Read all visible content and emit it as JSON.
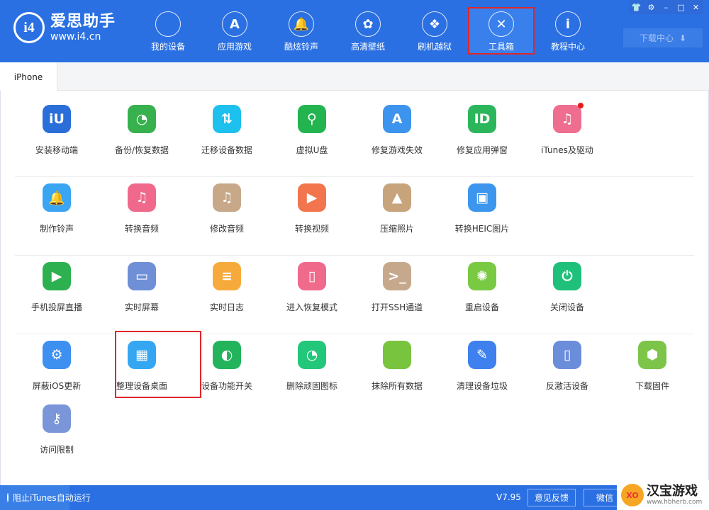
{
  "app": {
    "logo_mark": "i4",
    "name": "爱思助手",
    "url": "www.i4.cn"
  },
  "nav": [
    {
      "label": "我的设备",
      "icon": "apple-icon",
      "glyph": ""
    },
    {
      "label": "应用游戏",
      "icon": "app-store-icon",
      "glyph": "A"
    },
    {
      "label": "酷炫铃声",
      "icon": "bell-icon",
      "glyph": "🔔"
    },
    {
      "label": "高清壁纸",
      "icon": "flower-icon",
      "glyph": "✿"
    },
    {
      "label": "刷机越狱",
      "icon": "box-icon",
      "glyph": "❖"
    },
    {
      "label": "工具箱",
      "icon": "tools-icon",
      "glyph": "✕",
      "active": true
    },
    {
      "label": "教程中心",
      "icon": "info-icon",
      "glyph": "i"
    }
  ],
  "window_controls": {
    "skin": "👕",
    "settings": "⚙",
    "minimize": "–",
    "maximize": "□",
    "close": "✕"
  },
  "download_center": {
    "label": "下载中心",
    "glyph": "⬇"
  },
  "tabs": [
    {
      "label": "iPhone"
    }
  ],
  "tools": [
    {
      "label": "安装移动端",
      "icon": "i4-icon",
      "glyph": "iU",
      "color": "#2a6fd9"
    },
    {
      "label": "备份/恢复数据",
      "icon": "backup-clock-icon",
      "glyph": "◔",
      "color": "#36b14d"
    },
    {
      "label": "迁移设备数据",
      "icon": "transfer-phones-icon",
      "glyph": "⇅",
      "color": "#1ec0ee"
    },
    {
      "label": "虚拟U盘",
      "icon": "usb-icon",
      "glyph": "⚲",
      "color": "#23b450"
    },
    {
      "label": "修复游戏失效",
      "icon": "app-store-repair-icon",
      "glyph": "A",
      "color": "#3d94ee"
    },
    {
      "label": "修复应用弹窗",
      "icon": "apple-id-icon",
      "glyph": "ID",
      "color": "#2cb65c"
    },
    {
      "label": "iTunes及驱动",
      "icon": "itunes-icon",
      "glyph": "♫",
      "color": "#ef6d8e",
      "badge": true
    },
    {
      "label": "制作铃声",
      "icon": "bell-plus-icon",
      "glyph": "🔔",
      "color": "#3aa5f2"
    },
    {
      "label": "转换音频",
      "icon": "music-convert-icon",
      "glyph": "♫",
      "color": "#f0698d"
    },
    {
      "label": "修改音频",
      "icon": "music-edit-icon",
      "glyph": "♫",
      "color": "#c7a98a"
    },
    {
      "label": "转换视频",
      "icon": "video-play-icon",
      "glyph": "▶",
      "color": "#f2754d"
    },
    {
      "label": "压缩照片",
      "icon": "photo-icon",
      "glyph": "▲",
      "color": "#c8a47c"
    },
    {
      "label": "转换HEIC图片",
      "icon": "heic-image-icon",
      "glyph": "▣",
      "color": "#3d96ee"
    },
    {
      "label": "手机投屏直播",
      "icon": "phone-stream-icon",
      "glyph": "▶",
      "color": "#2db04f"
    },
    {
      "label": "实时屏幕",
      "icon": "monitor-icon",
      "glyph": "▭",
      "color": "#6f8fd6"
    },
    {
      "label": "实时日志",
      "icon": "log-document-icon",
      "glyph": "≡",
      "color": "#f7aa3c"
    },
    {
      "label": "进入恢复模式",
      "icon": "recovery-phone-icon",
      "glyph": "▯",
      "color": "#f06a8c"
    },
    {
      "label": "打开SSH通道",
      "icon": "terminal-icon",
      "glyph": ">_",
      "color": "#c6a98d"
    },
    {
      "label": "重启设备",
      "icon": "restart-icon",
      "glyph": "✺",
      "color": "#7ac943"
    },
    {
      "label": "关闭设备",
      "icon": "power-icon",
      "glyph": "⏻",
      "color": "#1fc17a"
    },
    {
      "label": "屏蔽iOS更新",
      "icon": "gear-block-icon",
      "glyph": "⚙",
      "color": "#3d8ff0"
    },
    {
      "label": "整理设备桌面",
      "icon": "grid-icon",
      "glyph": "▦",
      "color": "#35a7f2",
      "highlight": true
    },
    {
      "label": "设备功能开关",
      "icon": "toggle-icon",
      "glyph": "◐",
      "color": "#23b45b"
    },
    {
      "label": "删除顽固图标",
      "icon": "pie-icon",
      "glyph": "◔",
      "color": "#22c77a"
    },
    {
      "label": "抹除所有数据",
      "icon": "apple-erase-icon",
      "glyph": "",
      "color": "#79c43f"
    },
    {
      "label": "清理设备垃圾",
      "icon": "broom-icon",
      "glyph": "✎",
      "color": "#3e80ee"
    },
    {
      "label": "反激活设备",
      "icon": "deactivate-phone-icon",
      "glyph": "▯",
      "color": "#6b8edb"
    },
    {
      "label": "下载固件",
      "icon": "cube-icon",
      "glyph": "⬢",
      "color": "#7cc548"
    },
    {
      "label": "访问限制",
      "icon": "key-icon",
      "glyph": "⚷",
      "color": "#7a96d8"
    }
  ],
  "footer": {
    "itunes_block": "阻止iTunes自动运行",
    "version": "V7.95",
    "feedback": "意见反馈",
    "wechat": "微信"
  },
  "watermark": {
    "logo": "XO",
    "title": "汉宝游戏",
    "url": "www.hbherb.com"
  }
}
